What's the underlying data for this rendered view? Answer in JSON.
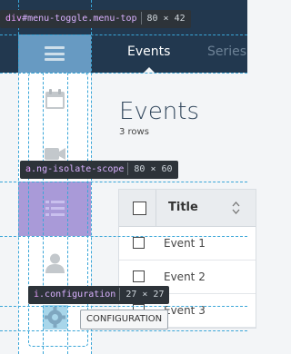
{
  "header": {
    "tabs": [
      {
        "label": "Events",
        "active": true
      },
      {
        "label": "Series",
        "active": false
      }
    ]
  },
  "sidebar": {
    "items": [
      {
        "icon": "calendar-icon",
        "active": false
      },
      {
        "icon": "video-camera-icon",
        "active": false
      },
      {
        "icon": "list-icon",
        "active": true
      },
      {
        "icon": "user-icon",
        "active": false
      },
      {
        "icon": "gear-icon",
        "active": false
      }
    ]
  },
  "main": {
    "title": "Events",
    "row_count": "3 rows",
    "table": {
      "column_title": "Title",
      "rows": [
        {
          "title": "Event 1"
        },
        {
          "title": "Event 2"
        },
        {
          "title": "Event 3"
        }
      ]
    }
  },
  "inspector": {
    "tooltip1": {
      "tag": "div",
      "selector": "#menu-toggle.menu-top",
      "dims": "80 × 42"
    },
    "tooltip2": {
      "tag": "a",
      "selector": ".ng-isolate-scope",
      "dims": "80 × 60"
    },
    "tooltip3": {
      "tag": "i",
      "selector": ".configuration",
      "dims": "27 × 27"
    },
    "hover_label": "CONFIGURATION"
  },
  "colors": {
    "topbar": "#22384f",
    "highlight": "#6ba0c9",
    "active_nav": "#a99ad8",
    "guide": "#3aa6d8"
  }
}
